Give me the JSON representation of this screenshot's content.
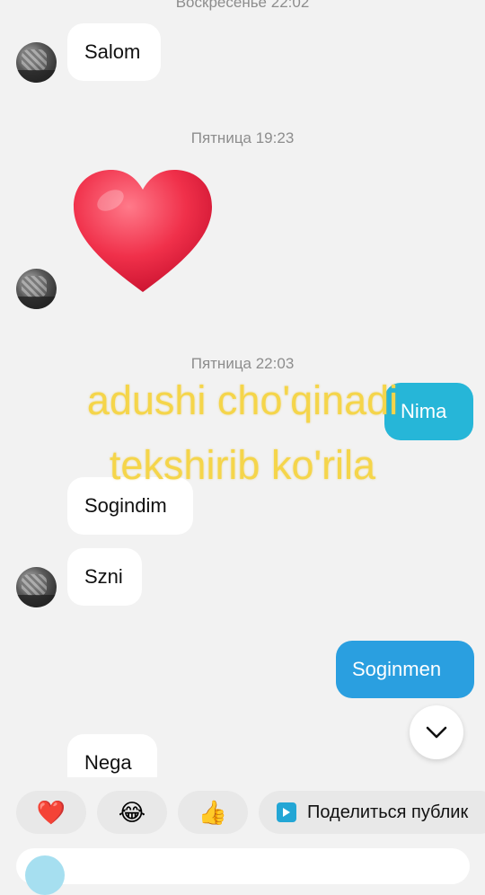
{
  "timestamps": {
    "sunday": "Воскресенье 22:02",
    "friday_1": "Пятница 19:23",
    "friday_2": "Пятница 22:03"
  },
  "messages": {
    "salom": "Salom",
    "heart": "heart",
    "nima": "Nima",
    "sogindim": "Sogindim",
    "szni": "Szni",
    "soginmen": "Soginmen",
    "nega": "Nega"
  },
  "overlay": {
    "line1": "adushi cho'qinadi",
    "line2": "tekshirib ko'rila"
  },
  "reactions": {
    "heart": "❤️",
    "laugh": "😂",
    "thumbs": "👍"
  },
  "share": {
    "label": "Поделиться публик"
  },
  "icons": {
    "scroll_down": "chevron-down-icon",
    "share": "play-icon"
  },
  "colors": {
    "background": "#f2f2f2",
    "incoming_bubble": "#ffffff",
    "outgoing_bubble": "#2a9fe0",
    "outgoing_bubble_cyan": "#26b6d8",
    "overlay_text": "#f5d54a",
    "timestamp_text": "#8d8d8d"
  }
}
